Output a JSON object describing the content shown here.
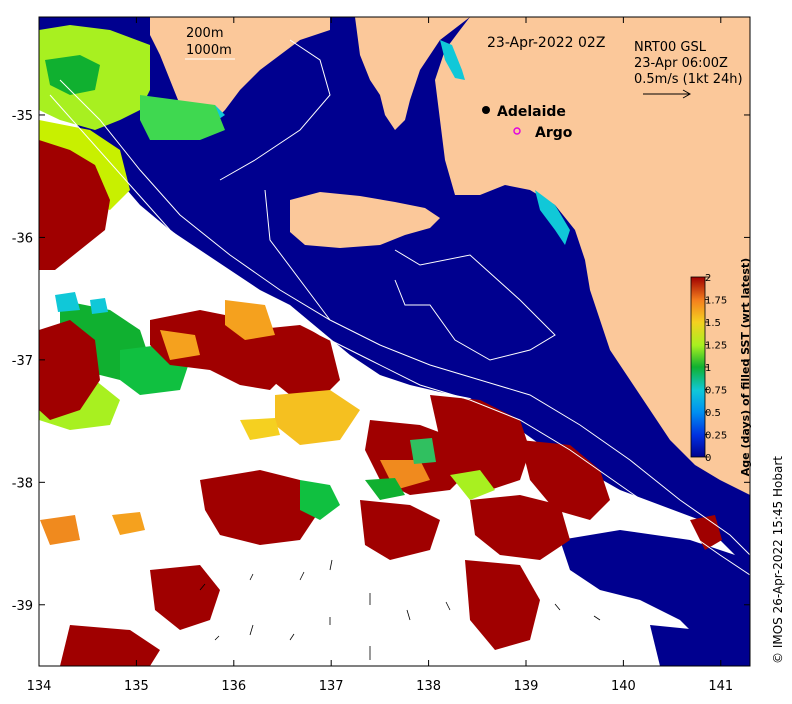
{
  "map": {
    "date_label": "23-Apr-2022 02Z",
    "product_lines": [
      "NRT00 GSL",
      "23-Apr 06:00Z",
      "0.5m/s (1kt 24h)"
    ],
    "depth_contours": [
      "200m",
      "1000m"
    ],
    "places": [
      {
        "name": "Adelaide",
        "marker": "filled-circle",
        "color": "#000000"
      },
      {
        "name": "Argo",
        "marker": "open-circle",
        "color": "#e000e0"
      }
    ],
    "x_ticks": [
      {
        "value": 134,
        "label": "134"
      },
      {
        "value": 135,
        "label": "135"
      },
      {
        "value": 136,
        "label": "136"
      },
      {
        "value": 137,
        "label": "137"
      },
      {
        "value": 138,
        "label": "138"
      },
      {
        "value": 139,
        "label": "139"
      },
      {
        "value": 140,
        "label": "140"
      },
      {
        "value": 141,
        "label": "141"
      }
    ],
    "y_ticks": [
      {
        "value": -35,
        "label": "-35"
      },
      {
        "value": -36,
        "label": "-36"
      },
      {
        "value": -37,
        "label": "-37"
      },
      {
        "value": -38,
        "label": "-38"
      },
      {
        "value": -39,
        "label": "-39"
      }
    ],
    "xlim": [
      134,
      141.3
    ],
    "ylim": [
      -39.5,
      -34.2
    ],
    "colorbar": {
      "title": "Age (days) of filled SST (wrt latest)",
      "ticks": [
        "2",
        "1.75",
        "1.5",
        "1.25",
        "1",
        "0.75",
        "0.5",
        "0.25",
        "0"
      ],
      "range": [
        0,
        2
      ]
    },
    "credit": "© IMOS 26-Apr-2022 15:45 Hobart",
    "colors": {
      "land": "#fbc89a",
      "ocean": "#00008f",
      "no_data": "#ffffff",
      "age_2": "#a00000",
      "age_1_5": "#f5a11e",
      "age_1": "#10b030",
      "age_0_5": "#10c8d8",
      "age_0": "#00008f"
    }
  }
}
